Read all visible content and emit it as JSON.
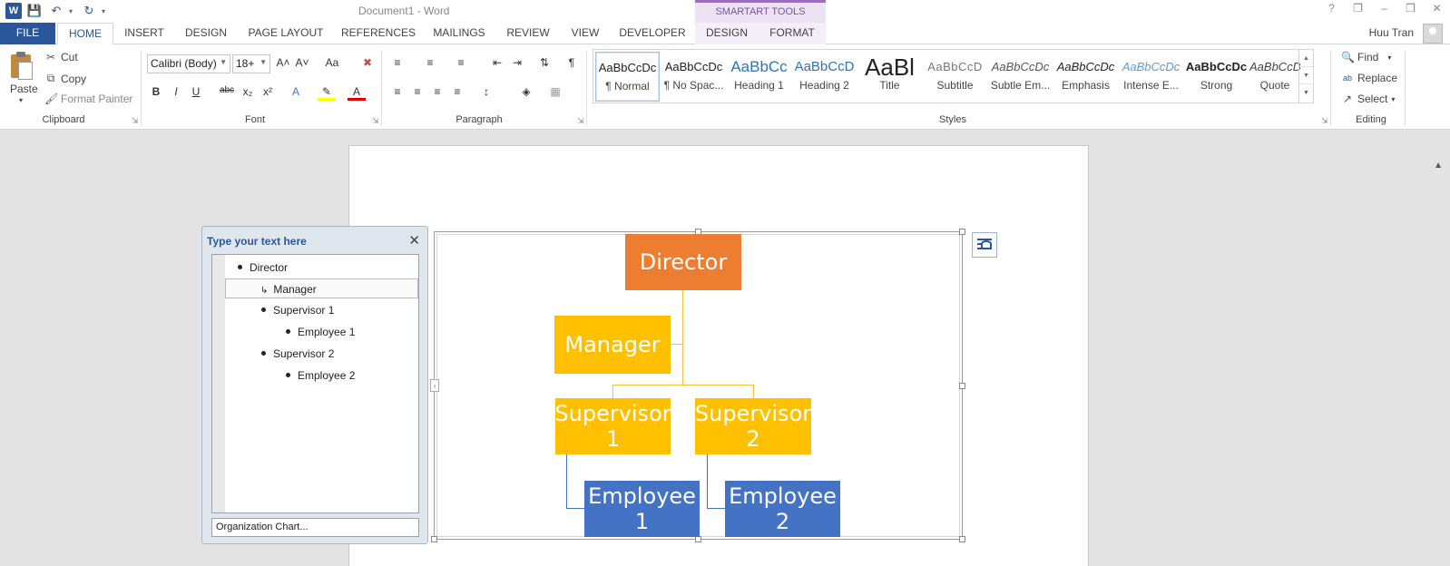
{
  "window": {
    "doc_title": "Document1 - Word",
    "context_header": "SMARTART TOOLS",
    "user_name": "Huu Tran",
    "controls": [
      "?",
      "❐",
      "–",
      "❒",
      "✕"
    ]
  },
  "tabs": [
    {
      "label": "FILE"
    },
    {
      "label": "HOME"
    },
    {
      "label": "INSERT"
    },
    {
      "label": "DESIGN"
    },
    {
      "label": "PAGE LAYOUT"
    },
    {
      "label": "REFERENCES"
    },
    {
      "label": "MAILINGS"
    },
    {
      "label": "REVIEW"
    },
    {
      "label": "VIEW"
    },
    {
      "label": "DEVELOPER"
    },
    {
      "label": "DESIGN"
    },
    {
      "label": "FORMAT"
    }
  ],
  "clipboard": {
    "paste": "Paste",
    "cut": "Cut",
    "copy": "Copy",
    "format_painter": "Format Painter",
    "label": "Clipboard"
  },
  "font": {
    "family": "Calibri (Body)",
    "size": "18+",
    "label": "Font",
    "grow": "A˄",
    "shrink": "A˅",
    "case": "Aa",
    "bold": "B",
    "italic": "I",
    "underline": "U",
    "strike": "abc",
    "subscript": "x₂",
    "superscript": "x²",
    "effects": "A",
    "font_color": "A"
  },
  "paragraph": {
    "label": "Paragraph",
    "pilcrow": "¶"
  },
  "styles": {
    "label": "Styles",
    "items": [
      {
        "sample": "AaBbCcDc",
        "name": "¶ Normal"
      },
      {
        "sample": "AaBbCcDc",
        "name": "¶ No Spac..."
      },
      {
        "sample": "AaBbCc",
        "name": "Heading 1"
      },
      {
        "sample": "AaBbCcD",
        "name": "Heading 2"
      },
      {
        "sample": "AaBl",
        "name": "Title"
      },
      {
        "sample": "AaBbCcD",
        "name": "Subtitle"
      },
      {
        "sample": "AaBbCcDc",
        "name": "Subtle Em..."
      },
      {
        "sample": "AaBbCcDc",
        "name": "Emphasis"
      },
      {
        "sample": "AaBbCcDc",
        "name": "Intense E..."
      },
      {
        "sample": "AaBbCcDc",
        "name": "Strong"
      },
      {
        "sample": "AaBbCcDc",
        "name": "Quote"
      }
    ]
  },
  "editing": {
    "label": "Editing",
    "find": "Find",
    "replace": "Replace",
    "select": "Select"
  },
  "text_pane": {
    "title": "Type your text here",
    "close": "✕",
    "items": [
      {
        "text": "Director"
      },
      {
        "text": "Manager"
      },
      {
        "text": "Supervisor 1"
      },
      {
        "text": "Employee 1"
      },
      {
        "text": "Supervisor 2"
      },
      {
        "text": "Employee 2"
      }
    ],
    "footer": "Organization Chart..."
  },
  "org_chart": {
    "director": "Director",
    "manager": "Manager",
    "supervisor1_a": "Supervisor",
    "supervisor1_b": "1",
    "supervisor2_a": "Supervisor",
    "supervisor2_b": "2",
    "employee1_a": "Employee",
    "employee1_b": "1",
    "employee2_a": "Employee",
    "employee2_b": "2",
    "colors": {
      "director": "#ed7d31",
      "manager": "#ffc000",
      "supervisor": "#ffc000",
      "employee": "#4472c4"
    }
  }
}
